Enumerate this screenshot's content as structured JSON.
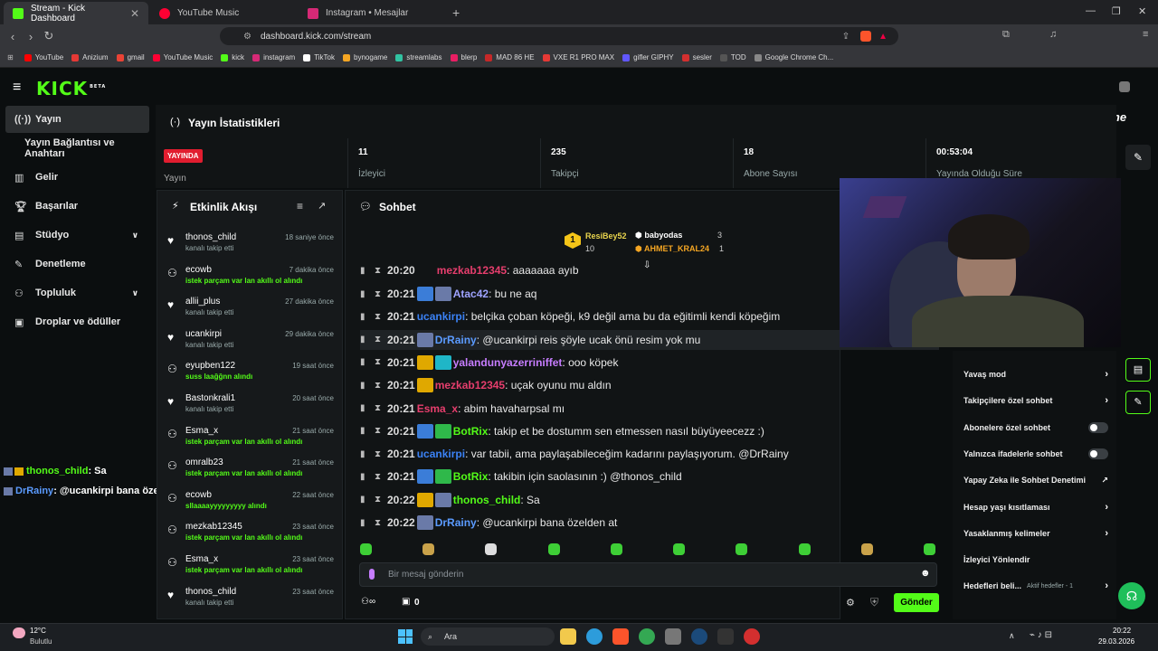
{
  "browser": {
    "tabs": [
      {
        "title": "Stream - Kick Dashboard",
        "color": "#53fc18"
      },
      {
        "title": "YouTube Music",
        "color": "#ff0033"
      },
      {
        "title": "Instagram • Mesajlar",
        "color": "#d62976"
      }
    ],
    "url": "dashboard.kick.com/stream",
    "bookmarks": [
      {
        "label": "YouTube",
        "color": "#ff0000"
      },
      {
        "label": "Anizium",
        "color": "#e53935"
      },
      {
        "label": "gmail",
        "color": "#ea4335"
      },
      {
        "label": "YouTube Music",
        "color": "#ff0033"
      },
      {
        "label": "kick",
        "color": "#53fc18"
      },
      {
        "label": "instagram",
        "color": "#d62976"
      },
      {
        "label": "TikTok",
        "color": "#ffffff"
      },
      {
        "label": "bynogame",
        "color": "#f5a623"
      },
      {
        "label": "streamlabs",
        "color": "#31c3a2"
      },
      {
        "label": "blerp",
        "color": "#e91e63"
      },
      {
        "label": "MAD 86 HE",
        "color": "#c62828"
      },
      {
        "label": "VXE R1 PRO MAX",
        "color": "#e53935"
      },
      {
        "label": "gifler GIPHY",
        "color": "#6157ff"
      },
      {
        "label": "sesler",
        "color": "#d32f2f"
      },
      {
        "label": "TOD",
        "color": "#555555"
      },
      {
        "label": "Google Chrome Ch...",
        "color": "#888888"
      }
    ]
  },
  "kick": {
    "logo": "KICK",
    "logo_beta": "BETA",
    "brand_overlay": "ByNoGame"
  },
  "sidebar": {
    "items": [
      {
        "label": "Yayın",
        "icon": "broadcast-icon"
      },
      {
        "label": "Yayın Bağlantısı ve Anahtarı"
      },
      {
        "label": "Gelir",
        "icon": "chart-icon"
      },
      {
        "label": "Başarılar",
        "icon": "trophy-icon"
      },
      {
        "label": "Stüdyo",
        "icon": "studio-icon"
      },
      {
        "label": "Denetleme",
        "icon": "wrench-icon"
      },
      {
        "label": "Topluluk",
        "icon": "community-icon"
      },
      {
        "label": "Droplar ve ödüller",
        "icon": "drops-icon"
      }
    ]
  },
  "stats": {
    "title": "Yayın İstatistikleri",
    "live_badge": "YAYINDA",
    "live_label": "Yayın",
    "items": [
      {
        "value": "11",
        "label": "İzleyici"
      },
      {
        "value": "235",
        "label": "Takipçi"
      },
      {
        "value": "18",
        "label": "Abone Sayısı"
      },
      {
        "value": "00:53:04",
        "label": "Yayında Olduğu Süre"
      }
    ]
  },
  "activity": {
    "title": "Etkinlik Akışı",
    "events": [
      {
        "name": "thonos_child",
        "sub": "kanalı takip etti",
        "time": "18 saniye önce",
        "kind": "follow"
      },
      {
        "name": "ecowb",
        "sub": "istek parçam var lan akıllı ol alındı",
        "time": "7 dakika önce",
        "kind": "reward"
      },
      {
        "name": "allii_plus",
        "sub": "kanalı takip etti",
        "time": "27 dakika önce",
        "kind": "follow"
      },
      {
        "name": "ucankirpi",
        "sub": "kanalı takip etti",
        "time": "29 dakika önce",
        "kind": "follow"
      },
      {
        "name": "eyupben122",
        "sub": "suss laağğnn alındı",
        "time": "19 saat önce",
        "kind": "reward"
      },
      {
        "name": "Bastonkrali1",
        "sub": "kanalı takip etti",
        "time": "20 saat önce",
        "kind": "follow"
      },
      {
        "name": "Esma_x",
        "sub": "istek parçam var lan akıllı ol alındı",
        "time": "21 saat önce",
        "kind": "reward"
      },
      {
        "name": "omralb23",
        "sub": "istek parçam var lan akıllı ol alındı",
        "time": "21 saat önce",
        "kind": "reward"
      },
      {
        "name": "ecowb",
        "sub": "sllaaaayyyyyyyyy alındı",
        "time": "22 saat önce",
        "kind": "reward"
      },
      {
        "name": "mezkab12345",
        "sub": "istek parçam var lan akıllı ol alındı",
        "time": "23 saat önce",
        "kind": "reward"
      },
      {
        "name": "Esma_x",
        "sub": "istek parçam var lan akıllı ol alındı",
        "time": "23 saat önce",
        "kind": "reward"
      },
      {
        "name": "thonos_child",
        "sub": "kanalı takip etti",
        "time": "23 saat önce",
        "kind": "follow"
      }
    ]
  },
  "chat": {
    "title": "Sohbet",
    "leaderboard": {
      "first_name": "ResiBey52",
      "first_count": "10",
      "rank": "1",
      "others": [
        {
          "name": "babyodas",
          "count": "3"
        },
        {
          "name": "AHMET_KRAL24",
          "count": "1"
        }
      ]
    },
    "partial_line": {
      "time": "20:20",
      "user": "mezkab12345",
      "text": ": aaaaaaa ayıb"
    },
    "messages": [
      {
        "time": "20:21",
        "user": "Atac42",
        "color": "#9ea3ff",
        "badges": [
          "#3b7dd8",
          "#6a7aa8"
        ],
        "text": ": bu ne aq"
      },
      {
        "time": "20:21",
        "user": "ucankirpi",
        "color": "#3b82f6",
        "badges": [],
        "text": ": belçika çoban köpeği, k9 değil ama bu da eğitimli kendi köpeğim"
      },
      {
        "time": "20:21",
        "user": "DrRainy",
        "color": "#5b9bff",
        "badges": [
          "#6a7aa8"
        ],
        "text": ": @ucankirpi reis şöyle ucak önü resim yok mu"
      },
      {
        "time": "20:21",
        "user": "yalandunyazerriniffet",
        "color": "#c77dff",
        "badges": [
          "#e0a800",
          "#1fb6c7"
        ],
        "text": ": ooo köpek"
      },
      {
        "time": "20:21",
        "user": "mezkab12345",
        "color": "#e63e6d",
        "badges": [
          "#e0a800"
        ],
        "text": ": uçak oyunu mu aldın"
      },
      {
        "time": "20:21",
        "user": "Esma_x",
        "color": "#e63e6d",
        "badges": [],
        "text": ": abim havaharpsal mı"
      },
      {
        "time": "20:21",
        "user": "BotRix",
        "color": "#53fc18",
        "badges": [
          "#3b7dd8",
          "#2fb84a"
        ],
        "text": ": takip et be dostumm sen etmessen nasıl büyüyeecezz :)"
      },
      {
        "time": "20:21",
        "user": "ucankirpi",
        "color": "#3b82f6",
        "badges": [],
        "text": ": var tabii, ama paylaşabileceğim kadarını paylaşıyorum. @DrRainy"
      },
      {
        "time": "20:21",
        "user": "BotRix",
        "color": "#53fc18",
        "badges": [
          "#3b7dd8",
          "#2fb84a"
        ],
        "text": ": takibin için saolasının :) @thonos_child"
      },
      {
        "time": "20:22",
        "user": "thonos_child",
        "color": "#53fc18",
        "badges": [
          "#e0a800",
          "#6a7aa8"
        ],
        "text": ": Sa"
      },
      {
        "time": "20:22",
        "user": "DrRainy",
        "color": "#5b9bff",
        "badges": [
          "#6a7aa8"
        ],
        "text": ": @ucankirpi bana özelden at"
      }
    ],
    "input_placeholder": "Bir mesaj gönderin",
    "send_label": "Gönder",
    "points_count": "0"
  },
  "overlay_chat": [
    {
      "user": "thonos_child",
      "text": ": Sa"
    },
    {
      "user": "DrRainy",
      "text": ": @ucankirpi bana özelden at"
    }
  ],
  "settings_menu": {
    "items": [
      {
        "label": "Yavaş mod",
        "control": "arrow"
      },
      {
        "label": "Takipçilere özel sohbet",
        "control": "arrow"
      },
      {
        "label": "Abonelere özel sohbet",
        "control": "toggle"
      },
      {
        "label": "Yalnızca ifadelerle sohbet",
        "control": "toggle"
      },
      {
        "label": "Yapay Zeka ile Sohbet Denetimi",
        "control": "external"
      },
      {
        "label": "Hesap yaşı kısıtlaması",
        "control": "arrow"
      },
      {
        "label": "Yasaklanmış kelimeler",
        "control": "arrow"
      },
      {
        "label": "İzleyici Yönlendir",
        "control": "none"
      },
      {
        "label": "Hedefleri beli...",
        "control": "arrow",
        "extra": "Aktif hedefler - 1"
      }
    ]
  },
  "taskbar": {
    "weather_temp": "12°C",
    "weather_desc": "Bulutlu",
    "search_label": "Ara",
    "time": "20:22",
    "date": "29.03.2026"
  },
  "colors": {
    "accent": "#53fc18",
    "bg": "#0b0e0f",
    "panel": "#16191b",
    "live": "#e11d2f"
  }
}
